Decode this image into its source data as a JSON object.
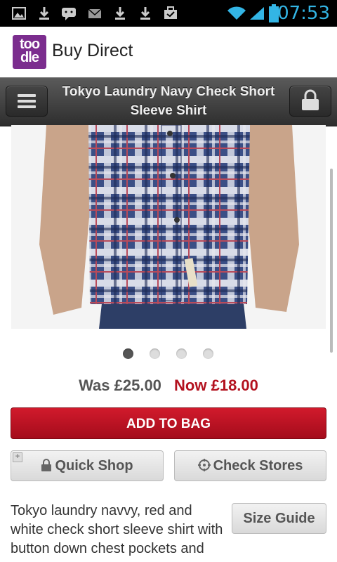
{
  "status_bar": {
    "time": "07:53",
    "icons": [
      "image-icon",
      "download-icon",
      "messenger-icon",
      "email-icon",
      "download-icon",
      "download-icon",
      "briefcase-icon",
      "wifi-icon",
      "signal-icon",
      "battery-icon"
    ]
  },
  "app_bar": {
    "logo_line1": "too",
    "logo_line2": "dle",
    "title": "Buy Direct"
  },
  "product_bar": {
    "title": "Tokyo Laundry Navy Check Short Sleeve Shirt"
  },
  "carousel": {
    "total_pages": 4,
    "active_page": 1
  },
  "price": {
    "was": "Was £25.00",
    "now": "Now £18.00"
  },
  "buttons": {
    "add_to_bag": "ADD TO BAG",
    "quick_shop": "Quick Shop",
    "check_stores": "Check Stores",
    "size_guide": "Size Guide"
  },
  "description": "Tokyo laundry navvy, red and white check short sleeve shirt with button down chest pockets and",
  "colors": {
    "accent_red": "#b3121f",
    "status_time": "#33b5e5",
    "brand_purple": "#7b2d8e"
  }
}
